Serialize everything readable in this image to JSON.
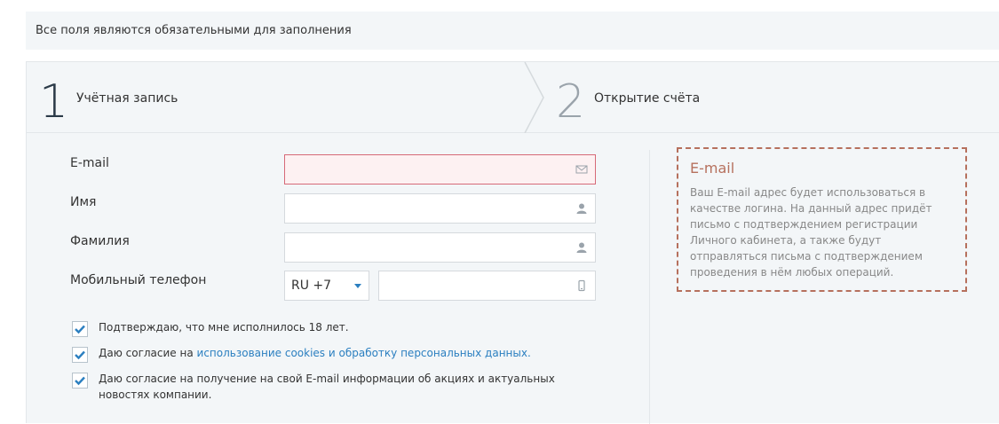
{
  "notice": "Все поля являются обязательными для заполнения",
  "steps": [
    {
      "num": "1",
      "label": "Учётная запись"
    },
    {
      "num": "2",
      "label": "Открытие счёта"
    }
  ],
  "form": {
    "email_label": "E-mail",
    "first_name_label": "Имя",
    "last_name_label": "Фамилия",
    "phone_label": "Мобильный телефон",
    "country_code": "RU +7"
  },
  "consents": {
    "age": "Подтверждаю, что мне исполнилось 18 лет.",
    "cookies_prefix": "Даю согласие на ",
    "cookies_link": "использование cookies и обработку персональных данных",
    "cookies_suffix": ".",
    "news": "Даю согласие на получение на свой E-mail информации об акциях и актуальных новостях компании."
  },
  "hint": {
    "title": "E-mail",
    "text": "Ваш E-mail адрес будет использоваться в качестве логина. На данный адрес придёт письмо с подтверждением регистрации Личного кабинета, а также будут отправляться письма с подтверждением проведения в нём любых операций."
  },
  "colors": {
    "accent": "#2b7fc0",
    "error_border": "#d66a78",
    "hint_border": "#b6705d"
  },
  "icons": [
    "envelope-icon",
    "user-icon",
    "user-icon",
    "mobile-icon",
    "checkmark-icon"
  ]
}
